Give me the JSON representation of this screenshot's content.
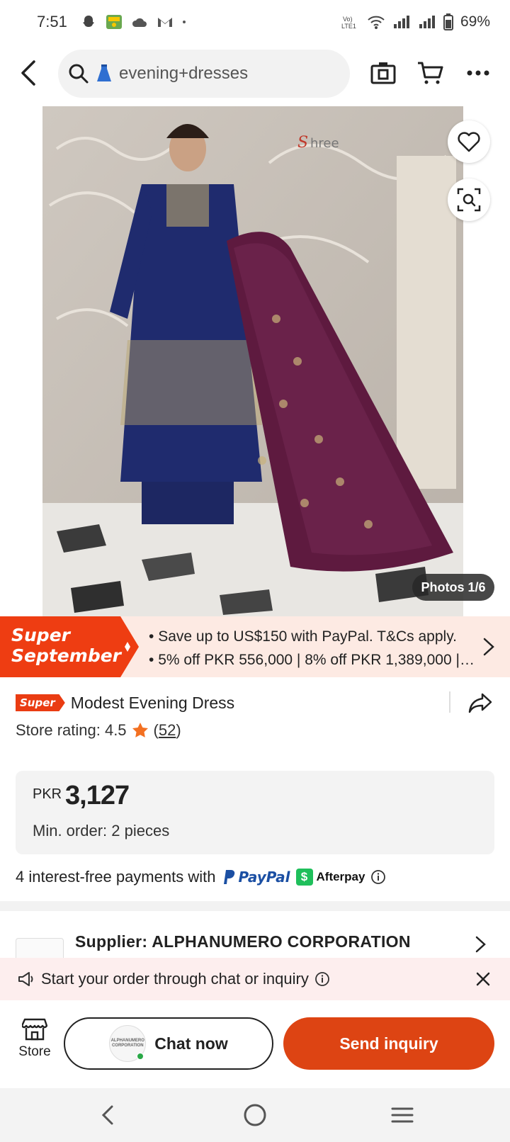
{
  "status_bar": {
    "time": "7:51",
    "battery": "69%",
    "left_icons": [
      "snapchat-icon",
      "app-notification-icon",
      "cloud-icon",
      "gmail-icon",
      "dot-icon"
    ],
    "right_icons": [
      "volte-icon",
      "wifi-icon",
      "signal-icon",
      "signal-icon",
      "battery-icon"
    ]
  },
  "search": {
    "query": "evening+dresses"
  },
  "gallery": {
    "photos_label": "Photos 1/6"
  },
  "promo": {
    "badge_line1": "Super",
    "badge_line2": "September",
    "line1": "Save up to US$150 with PayPal. T&Cs apply.",
    "line2": "5% off PKR 556,000 | 8% off PKR 1,389,000 | 1...",
    "colors": {
      "badge": "#ee3d12",
      "background": "#fdeae3"
    }
  },
  "product": {
    "tag": "Super",
    "title": "Modest Evening Dress",
    "rating_label": "Store rating: 4.5",
    "rating_count": "52",
    "rating_open": "(",
    "rating_close": ")"
  },
  "price": {
    "currency": "PKR",
    "value": "3,127",
    "min_order": "Min. order: 2 pieces"
  },
  "payments": {
    "text": "4 interest-free payments with",
    "paypal": "PayPal",
    "afterpay": "Afterpay"
  },
  "supplier": {
    "label": "Supplier:",
    "name": "ALPHANUMERO CORPORATION"
  },
  "chat_hint": {
    "text": "Start your order through chat or inquiry"
  },
  "bottom": {
    "store_label": "Store",
    "chat_label": "Chat now",
    "inquiry_label": "Send inquiry",
    "avatar_text": "ALPHANUMERO CORPORATION",
    "colors": {
      "inquiry": "#dd4413",
      "online": "#29a847"
    }
  }
}
